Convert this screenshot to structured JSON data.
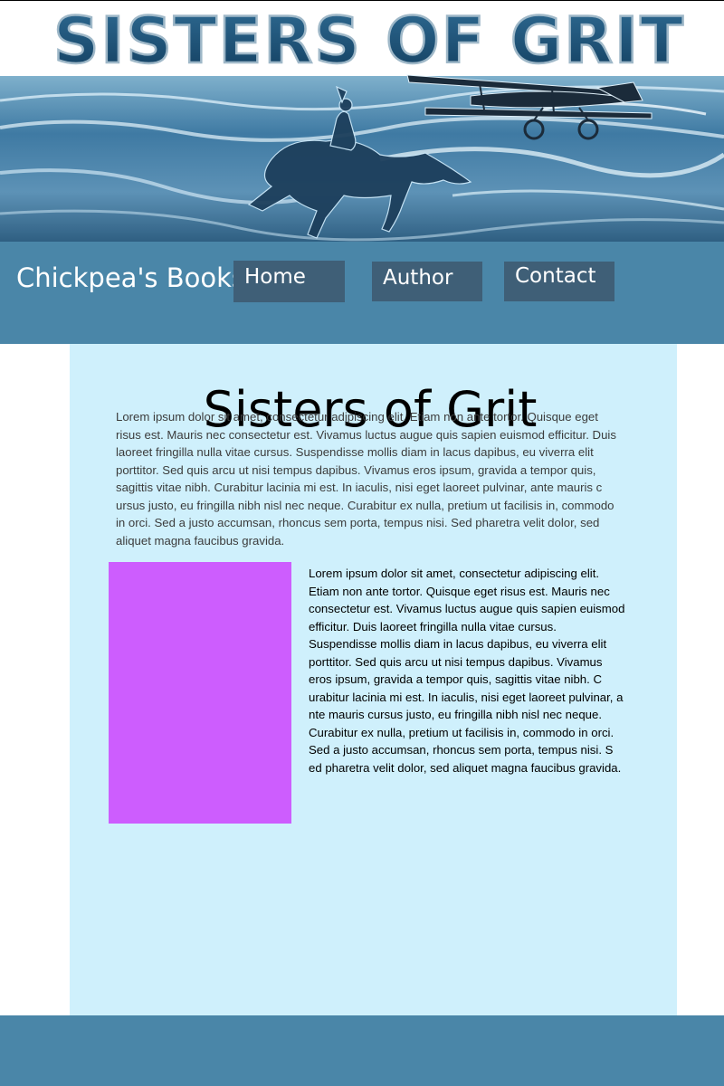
{
  "banner": {
    "logo_text": "SISTERS OF GRIT"
  },
  "nav": {
    "site_name": "Chickpea's Books",
    "items": [
      {
        "label": "Home"
      },
      {
        "label": "Author"
      },
      {
        "label": "Contact"
      }
    ]
  },
  "main": {
    "title": "Sisters of Grit",
    "intro": "Lorem ipsum dolor sit amet, consectetur adipiscing elit. Etiam non ante tortor. Quisque eget\nrisus est. Mauris nec consectetur est. Vivamus luctus augue quis sapien euismod efficitur. Duis\nlaoreet fringilla nulla vitae cursus. Suspendisse mollis diam in lacus dapibus, eu viverra elit\nporttitor. Sed quis arcu ut nisi tempus dapibus. Vivamus eros ipsum, gravida a tempor quis,\n sagittis vitae nibh. Curabitur lacinia mi est. In iaculis, nisi eget laoreet pulvinar, ante mauris c\nursus justo, eu fringilla nibh nisl nec neque. Curabitur ex nulla, pretium ut facilisis in, commodo\nin orci. Sed a justo accumsan, rhoncus sem porta, tempus nisi. Sed pharetra velit dolor, sed\naliquet magna faucibus gravida.",
    "side_text": "Lorem ipsum dolor sit amet, consectetur adipiscing elit.\nEtiam non ante tortor. Quisque eget risus est. Mauris nec\nconsectetur est. Vivamus luctus augue quis sapien euismod\nefficitur. Duis laoreet fringilla nulla vitae cursus.\nSuspendisse mollis diam in lacus dapibus, eu viverra elit\nporttitor. Sed quis arcu ut nisi tempus dapibus. Vivamus\neros ipsum, gravida a tempor quis, sagittis vitae nibh. C\nurabitur lacinia mi est. In iaculis, nisi eget laoreet pulvinar, a\nnte mauris cursus justo, eu fringilla nibh nisl nec neque.\nCurabitur ex nulla, pretium ut facilisis in, commodo in orci.\nSed a justo accumsan, rhoncus sem porta, tempus nisi. S\ned pharetra velit dolor, sed aliquet magna faucibus gravida."
  },
  "colors": {
    "nav_bg": "#4a86a8",
    "nav_button_bg": "#3f5f77",
    "content_bg": "#cff0fc",
    "cover_placeholder": "#cd5dfe",
    "footer_bg": "#4a86a8"
  },
  "icons": {
    "banner_art": "horse-rider-and-biplane-over-sea-illustration"
  }
}
